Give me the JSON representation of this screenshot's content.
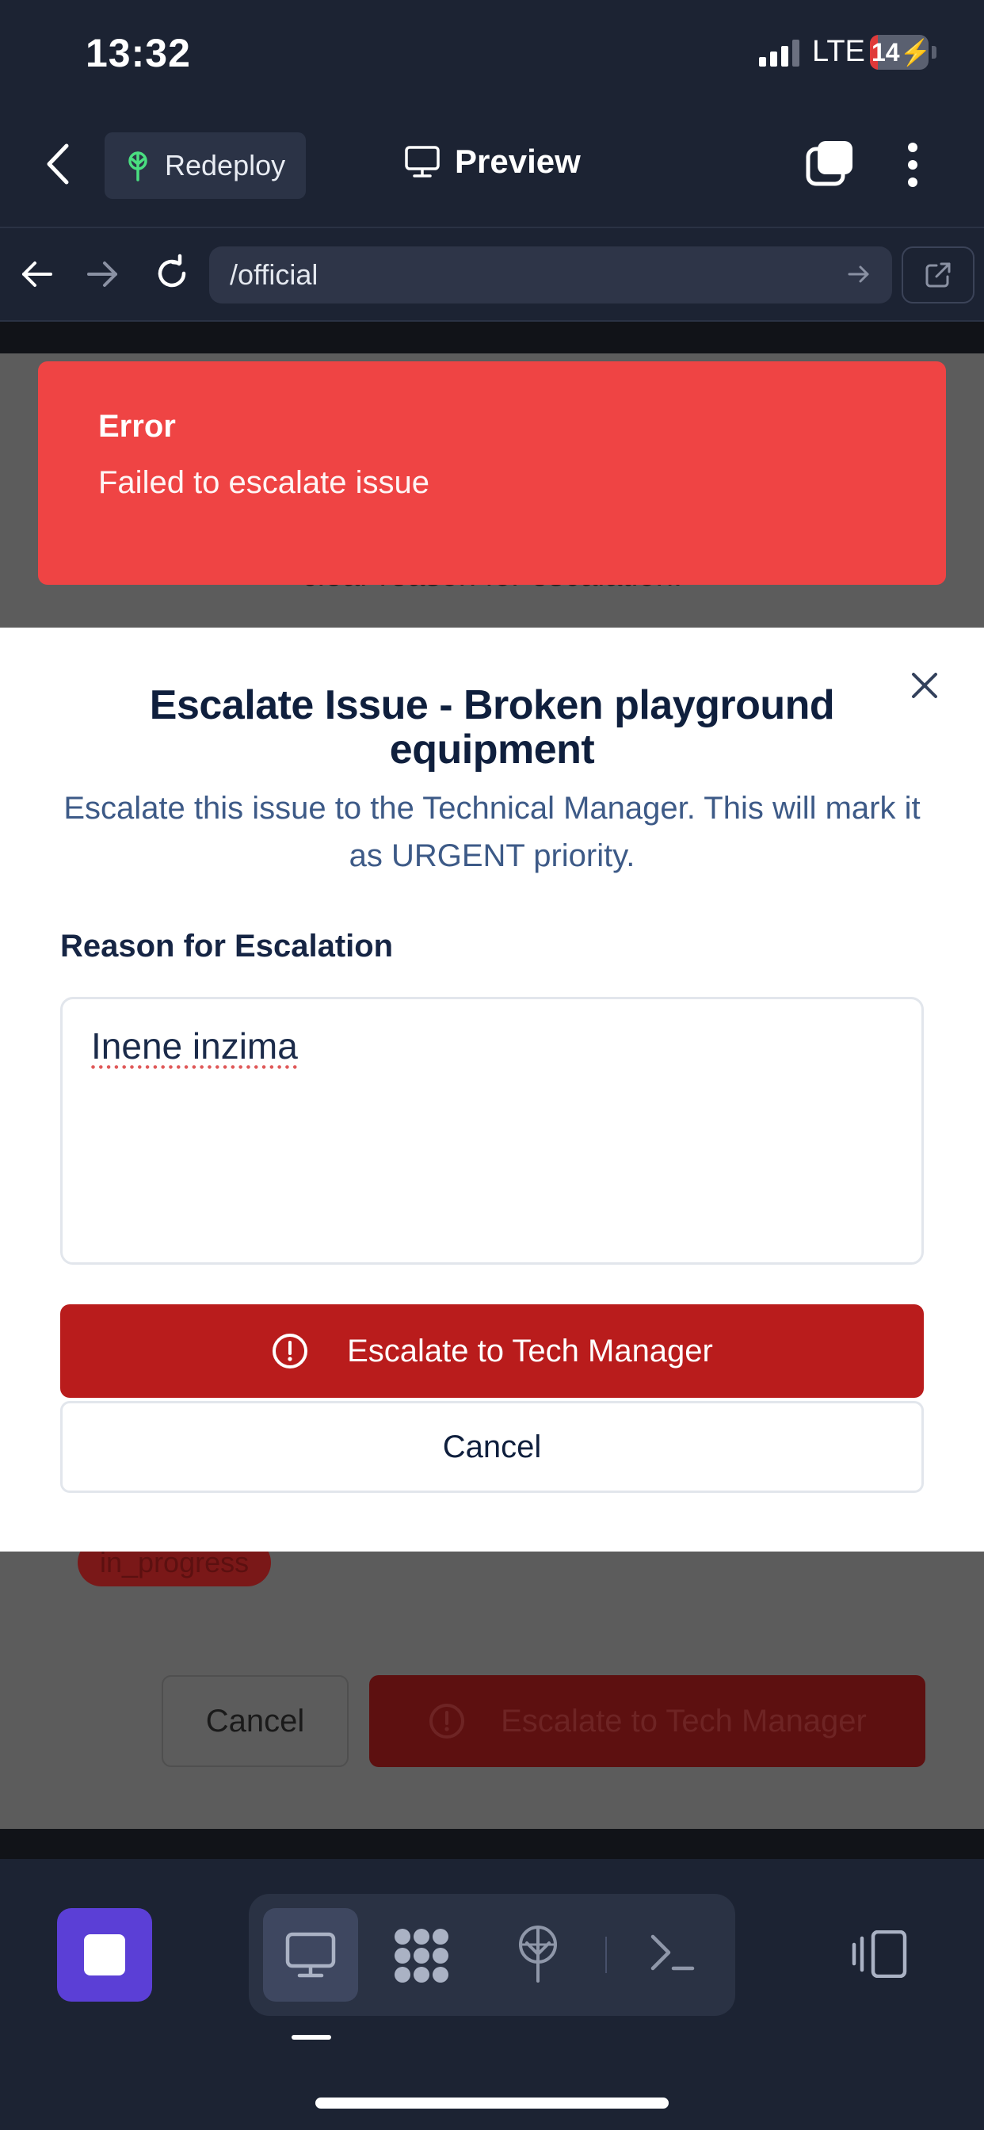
{
  "status_bar": {
    "time": "13:32",
    "network": "LTE",
    "battery": "14",
    "battery_level": 0.14,
    "icons": [
      "signal-icon",
      "battery-charging-icon"
    ]
  },
  "header": {
    "redeploy_label": "Redeploy",
    "preview_label": "Preview",
    "icons": [
      "back-chevron-icon",
      "redeploy-icon",
      "monitor-icon",
      "tabs-icon",
      "more-vertical-icon"
    ]
  },
  "browser": {
    "url": "/official",
    "icons": [
      "arrow-left-icon",
      "arrow-right-icon",
      "reload-icon",
      "go-arrow-icon",
      "external-link-icon"
    ]
  },
  "background_page": {
    "text": "clear reason for escalation.",
    "status_badge": "in_progress",
    "cancel_label": "Cancel",
    "escalate_label": "Escalate to Tech Manager"
  },
  "toast": {
    "title": "Error",
    "message": "Failed to escalate issue"
  },
  "modal": {
    "title": "Escalate Issue - Broken playground equipment",
    "description": "Escalate this issue to the Technical Manager. This will mark it as URGENT priority.",
    "reason_label": "Reason for Escalation",
    "reason_value": "Inene inzima",
    "escalate_label": "Escalate to Tech Manager",
    "cancel_label": "Cancel"
  },
  "toolbar": {
    "items": [
      "stop-icon",
      "monitor-icon",
      "apps-icon",
      "deploy-icon",
      "terminal-icon",
      "device-layout-icon"
    ],
    "active": "monitor-icon"
  },
  "colors": {
    "chrome_bg": "#1c2333",
    "toast_bg": "#ef4444",
    "primary_danger": "#b91c1c",
    "accent_purple": "#5b3fd6",
    "redeploy_icon": "#4ade80"
  }
}
